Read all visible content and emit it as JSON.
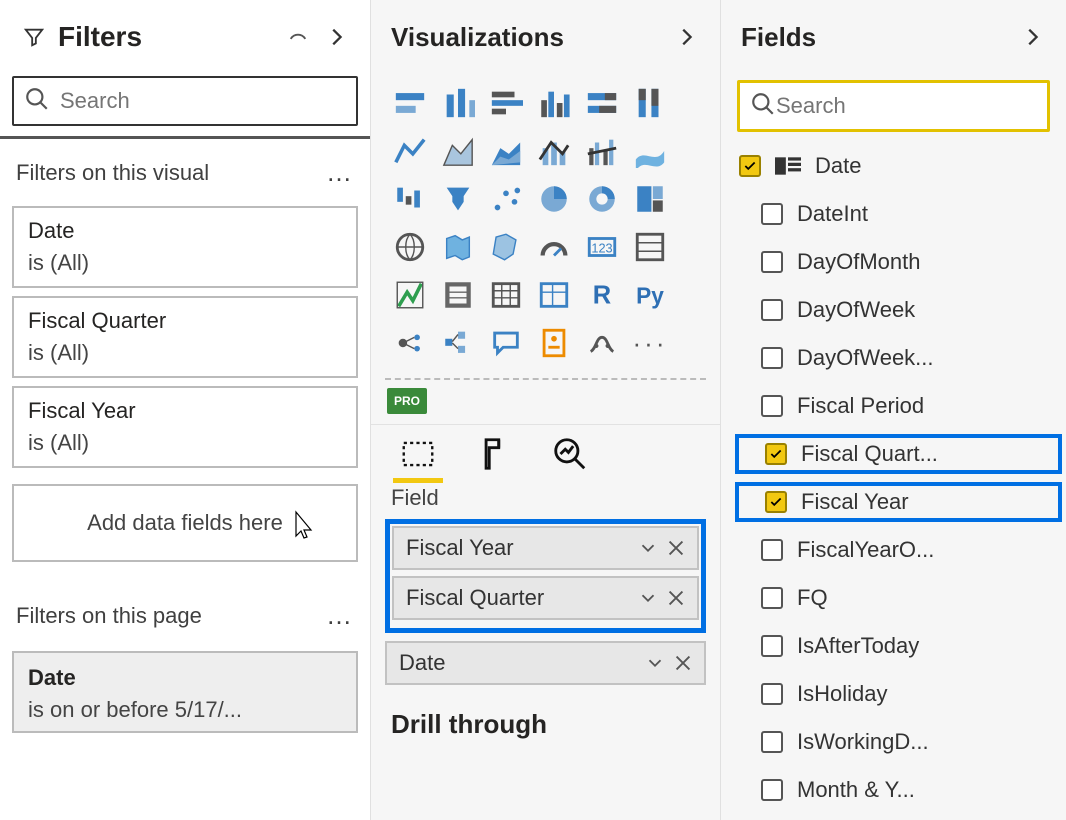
{
  "filters": {
    "title": "Filters",
    "search_placeholder": "Search",
    "visual_section": "Filters on this visual",
    "items": [
      {
        "name": "Date",
        "state": "is (All)"
      },
      {
        "name": "Fiscal Quarter",
        "state": "is (All)"
      },
      {
        "name": "Fiscal Year",
        "state": "is (All)"
      }
    ],
    "add_placeholder": "Add data fields here",
    "page_section": "Filters on this page",
    "page_item": {
      "name": "Date",
      "state": "is on or before 5/17/..."
    }
  },
  "viz": {
    "title": "Visualizations",
    "field_label": "Field",
    "wells": [
      {
        "name": "Fiscal Year"
      },
      {
        "name": "Fiscal Quarter"
      },
      {
        "name": "Date"
      }
    ],
    "drill": "Drill through",
    "pro_label": "PRO",
    "gallery_icons": [
      "stacked-bar",
      "stacked-column",
      "clustered-bar",
      "clustered-column",
      "100-stacked-bar",
      "100-stacked-column",
      "line",
      "area",
      "stacked-area",
      "line-stacked-column",
      "line-clustered-column",
      "ribbon",
      "waterfall",
      "funnel",
      "scatter",
      "pie",
      "donut",
      "treemap",
      "map",
      "filled-map",
      "shape-map",
      "gauge",
      "card",
      "multi-row-card",
      "kpi",
      "slicer",
      "table",
      "matrix",
      "r-visual",
      "py-visual",
      "key-influencers",
      "decomposition",
      "qna",
      "paginated",
      "arcgis",
      "more"
    ]
  },
  "fields": {
    "title": "Fields",
    "search_placeholder": "Search",
    "table": "Date",
    "columns": [
      {
        "name": "DateInt",
        "checked": false
      },
      {
        "name": "DayOfMonth",
        "checked": false
      },
      {
        "name": "DayOfWeek",
        "checked": false
      },
      {
        "name": "DayOfWeek...",
        "checked": false
      },
      {
        "name": "Fiscal Period",
        "checked": false
      },
      {
        "name": "Fiscal Quart...",
        "checked": true,
        "hi": true
      },
      {
        "name": "Fiscal Year",
        "checked": true,
        "hi": true
      },
      {
        "name": "FiscalYearO...",
        "checked": false
      },
      {
        "name": "FQ",
        "checked": false
      },
      {
        "name": "IsAfterToday",
        "checked": false
      },
      {
        "name": "IsHoliday",
        "checked": false
      },
      {
        "name": "IsWorkingD...",
        "checked": false
      },
      {
        "name": "Month & Y...",
        "checked": false
      }
    ]
  }
}
